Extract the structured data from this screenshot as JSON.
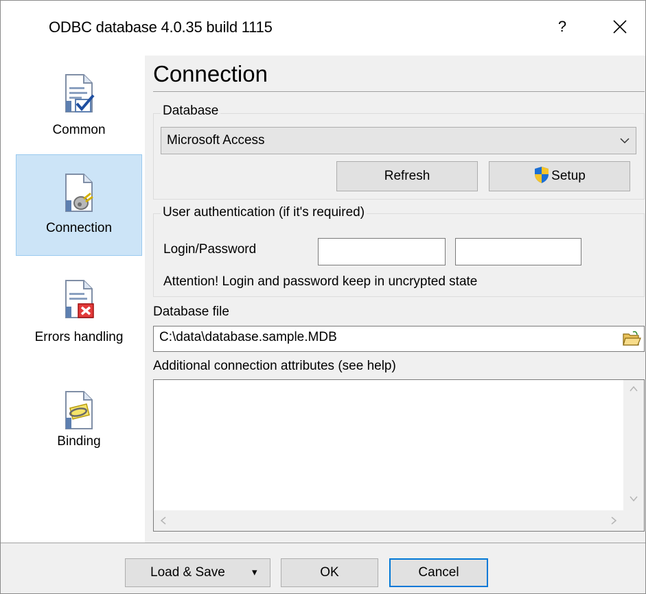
{
  "window": {
    "title": "ODBC database 4.0.35 build 1115",
    "help_glyph": "?",
    "close_glyph": "✕"
  },
  "sidebar": {
    "items": [
      {
        "label": "Common",
        "icon": "document-check-icon",
        "selected": false
      },
      {
        "label": "Connection",
        "icon": "document-plug-icon",
        "selected": true
      },
      {
        "label": "Errors handling",
        "icon": "document-error-icon",
        "selected": false
      },
      {
        "label": "Binding",
        "icon": "document-clip-icon",
        "selected": false
      }
    ]
  },
  "main": {
    "heading": "Connection",
    "database_group": {
      "label": "Database",
      "selected_value": "Microsoft Access",
      "refresh_label": "Refresh",
      "setup_label": "Setup"
    },
    "auth_group": {
      "label": "User authentication (if it's required)",
      "login_label": "Login/Password",
      "login_value": "",
      "password_value": "",
      "notice": "Attention! Login and password keep in uncrypted state"
    },
    "database_file": {
      "label": "Database file",
      "value": "C:\\data\\database.sample.MDB"
    },
    "attributes": {
      "label": "Additional connection attributes (see help)",
      "value": ""
    }
  },
  "footer": {
    "load_save_label": "Load & Save",
    "dropdown_glyph": "▾",
    "ok_label": "OK",
    "cancel_label": "Cancel"
  },
  "colors": {
    "selected_bg": "#cce4f7",
    "selected_border": "#99c9ef",
    "default_button_border": "#0078d7"
  }
}
